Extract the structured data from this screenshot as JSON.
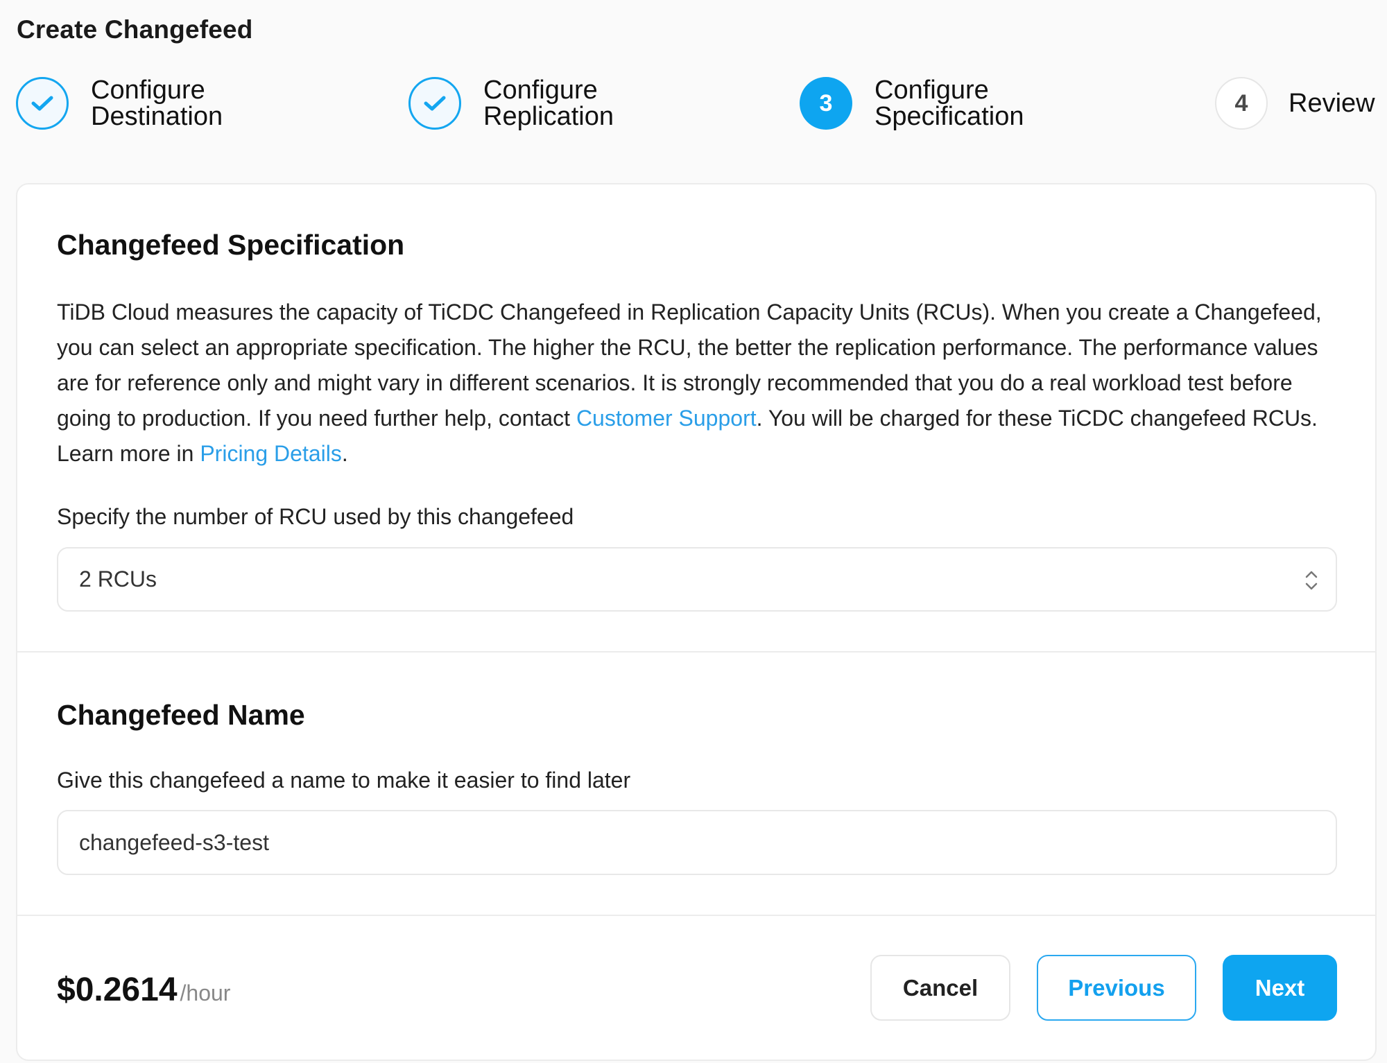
{
  "page": {
    "title": "Create Changefeed"
  },
  "steps": [
    {
      "number": "1",
      "state": "done",
      "line1": "Configure",
      "line2": "Destination"
    },
    {
      "number": "2",
      "state": "done",
      "line1": "Configure",
      "line2": "Replication"
    },
    {
      "number": "3",
      "state": "active",
      "line1": "Configure",
      "line2": "Specification"
    },
    {
      "number": "4",
      "state": "todo",
      "line1": "Review",
      "line2": ""
    }
  ],
  "spec": {
    "title": "Changefeed Specification",
    "desc_part1": "TiDB Cloud measures the capacity of TiCDC Changefeed in Replication Capacity Units (RCUs). When you create a Changefeed, you can select an appropriate specification. The higher the RCU, the better the replication performance. The performance values are for reference only and might vary in different scenarios. It is strongly recommended that you do a real workload test before going to production. If you need further help, contact ",
    "link_support": "Customer Support",
    "desc_part2": ". You will be charged for these TiCDC changefeed RCUs. Learn more in ",
    "link_pricing": "Pricing Details",
    "desc_part3": ".",
    "rcu_label": "Specify the number of RCU used by this changefeed",
    "rcu_value": "2 RCUs"
  },
  "name_section": {
    "title": "Changefeed Name",
    "label": "Give this changefeed a name to make it easier to find later",
    "value": "changefeed-s3-test"
  },
  "footer": {
    "price": "$0.2614",
    "price_unit": "/hour",
    "cancel": "Cancel",
    "previous": "Previous",
    "next": "Next"
  },
  "colors": {
    "accent": "#0ea5f0",
    "link": "#2a9ee8"
  }
}
